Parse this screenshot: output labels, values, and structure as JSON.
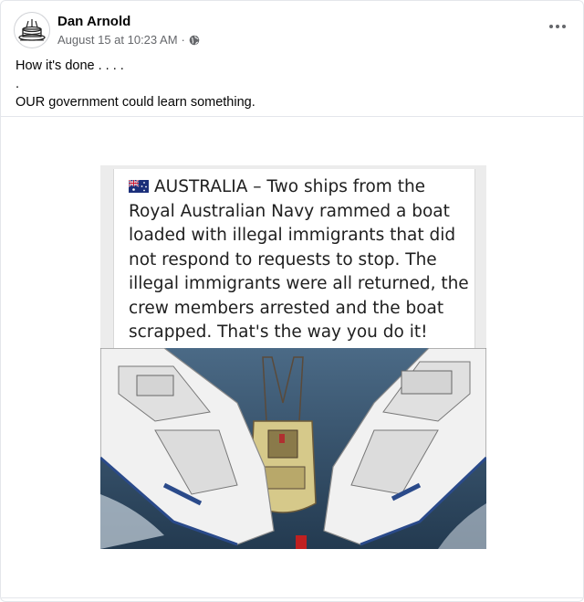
{
  "post": {
    "author": "Dan Arnold",
    "timestamp": "August 15 at 10:23 AM",
    "separator": "·",
    "audience_icon": "globe-icon",
    "more_icon": "more-options-icon",
    "text_lines": [
      "How it's done . . . .",
      ".",
      "OUR government could learn something."
    ]
  },
  "meme": {
    "flag_icon": "australia-flag-icon",
    "caption_lines": [
      "AUSTRALIA – Two ships from  the",
      "Royal Australian Navy rammed a boat",
      "loaded with illegal immigrants that did",
      "not respond to requests to stop. The",
      "illegal immigrants were all returned, the",
      "crew members arrested and the boat",
      "scrapped. That's the way you do it!"
    ]
  },
  "colors": {
    "secondary_text": "#65676b",
    "border": "#e4e6eb",
    "navy_hull": "#f2f2f2",
    "sea": "#3a5a78"
  }
}
